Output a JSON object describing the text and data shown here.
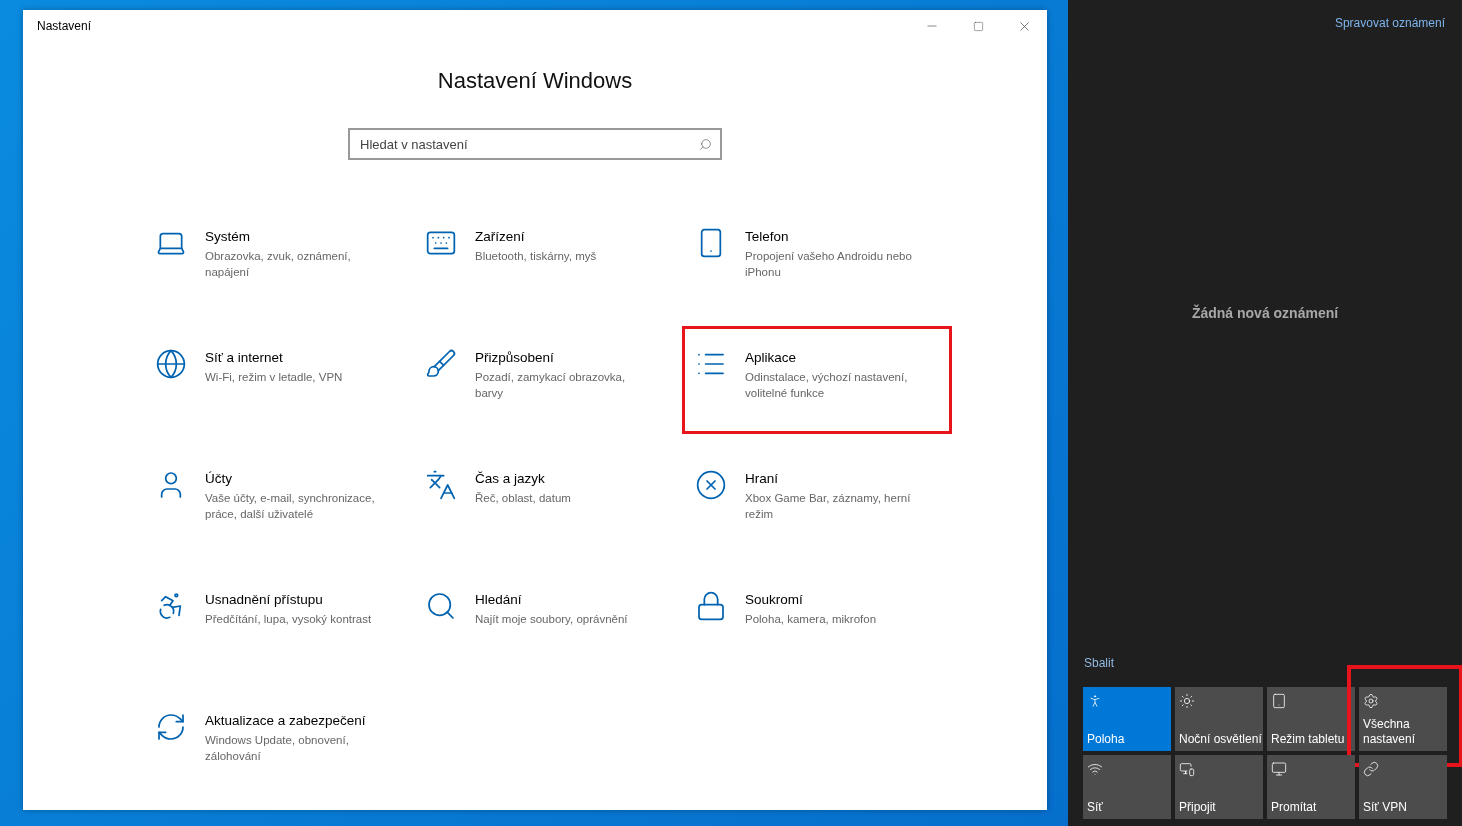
{
  "window": {
    "title": "Nastavení",
    "heading": "Nastavení Windows"
  },
  "search": {
    "placeholder": "Hledat v nastavení"
  },
  "categories": [
    {
      "title": "Systém",
      "description": "Obrazovka, zvuk, oznámení, napájení",
      "highlighted": false
    },
    {
      "title": "Zařízení",
      "description": "Bluetooth, tiskárny, myš",
      "highlighted": false
    },
    {
      "title": "Telefon",
      "description": "Propojení vašeho Androidu nebo iPhonu",
      "highlighted": false
    },
    {
      "title": "Síť a internet",
      "description": "Wi-Fi, režim v letadle, VPN",
      "highlighted": false
    },
    {
      "title": "Přizpůsobení",
      "description": "Pozadí, zamykací obrazovka, barvy",
      "highlighted": false
    },
    {
      "title": "Aplikace",
      "description": "Odinstalace, výchozí nastavení, volitelné funkce",
      "highlighted": true
    },
    {
      "title": "Účty",
      "description": "Vaše účty, e-mail, synchronizace, práce, další uživatelé",
      "highlighted": false
    },
    {
      "title": "Čas a jazyk",
      "description": "Řeč, oblast, datum",
      "highlighted": false
    },
    {
      "title": "Hraní",
      "description": "Xbox Game Bar, záznamy, herní režim",
      "highlighted": false
    },
    {
      "title": "Usnadnění přístupu",
      "description": "Předčítání, lupa, vysoký kontrast",
      "highlighted": false
    },
    {
      "title": "Hledání",
      "description": "Najít moje soubory, oprávnění",
      "highlighted": false
    },
    {
      "title": "Soukromí",
      "description": "Poloha, kamera, mikrofon",
      "highlighted": false
    },
    {
      "title": "Aktualizace a zabezpečení",
      "description": "Windows Update, obnovení, zálohování",
      "highlighted": false
    }
  ],
  "action_center": {
    "manage_link": "Spravovat oznámení",
    "empty_message": "Žádná nová oznámení",
    "collapse_link": "Sbalit",
    "tiles": [
      {
        "label": "Poloha",
        "on": true,
        "highlighted": false
      },
      {
        "label": "Noční osvětlení",
        "on": false,
        "highlighted": false
      },
      {
        "label": "Režim tabletu",
        "on": false,
        "highlighted": false
      },
      {
        "label": "Všechna nastavení",
        "on": false,
        "highlighted": true
      },
      {
        "label": "Síť",
        "on": false,
        "highlighted": false
      },
      {
        "label": "Připojit",
        "on": false,
        "highlighted": false
      },
      {
        "label": "Promítat",
        "on": false,
        "highlighted": false
      },
      {
        "label": "Síť VPN",
        "on": false,
        "highlighted": false
      }
    ]
  }
}
